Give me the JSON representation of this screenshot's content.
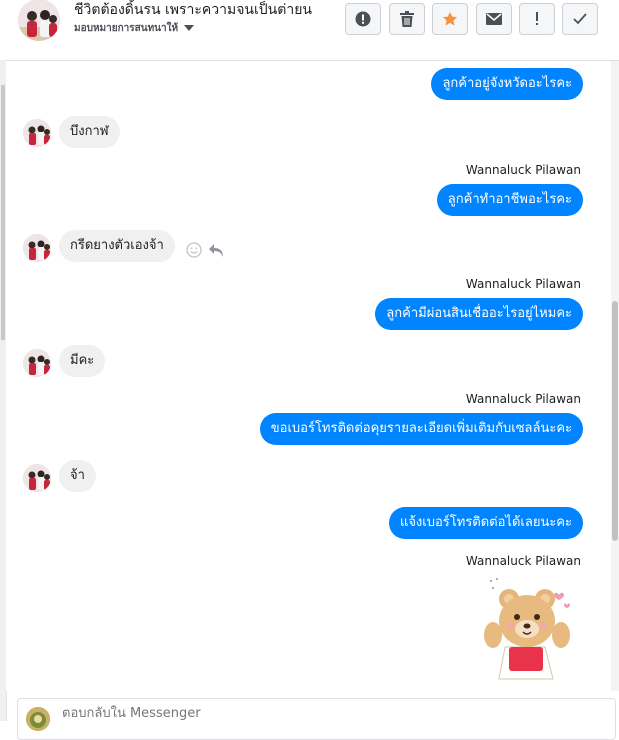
{
  "header": {
    "title": "ชีวิตต้องดิ้นรน เพราะความจนเป็นต่ายน",
    "subtitle": "มอบหมายการสนทนาให้",
    "toolbar": [
      {
        "name": "alert-icon"
      },
      {
        "name": "trash-icon"
      },
      {
        "name": "star-icon"
      },
      {
        "name": "mail-icon"
      },
      {
        "name": "exclamation-icon"
      },
      {
        "name": "check-icon"
      }
    ],
    "accent": "#0084ff"
  },
  "messages": [
    {
      "dir": "out",
      "text": "ลูกค้าอยู่จังหวัดอะไรคะ"
    },
    {
      "dir": "in",
      "text": "บึงกาฬ"
    },
    {
      "dir": "out",
      "sender": "Wannaluck Pilawan",
      "text": "ลูกค้าทำอาชีพอะไรคะ"
    },
    {
      "dir": "in",
      "text": "กรีดยางตัวเองจ้า"
    },
    {
      "dir": "out",
      "sender": "Wannaluck Pilawan",
      "text": "ลูกค้ามีผ่อนสินเชื่ออะไรอยู่ไหมคะ"
    },
    {
      "dir": "in",
      "text": "มีคะ"
    },
    {
      "dir": "out",
      "sender": "Wannaluck Pilawan",
      "text": "ขอเบอร์โทรติดต่อคุยรายละเอียดเพิ่มเติมกับเซลล์นะคะ"
    },
    {
      "dir": "in",
      "text": "จ้า"
    },
    {
      "dir": "out",
      "text": "แจ้งเบอร์โทรติดต่อได้เลยนะคะ"
    },
    {
      "dir": "out",
      "sender": "Wannaluck Pilawan",
      "sticker": "bear-sticker"
    }
  ],
  "composer": {
    "placeholder": "ตอบกลับใน Messenger"
  }
}
